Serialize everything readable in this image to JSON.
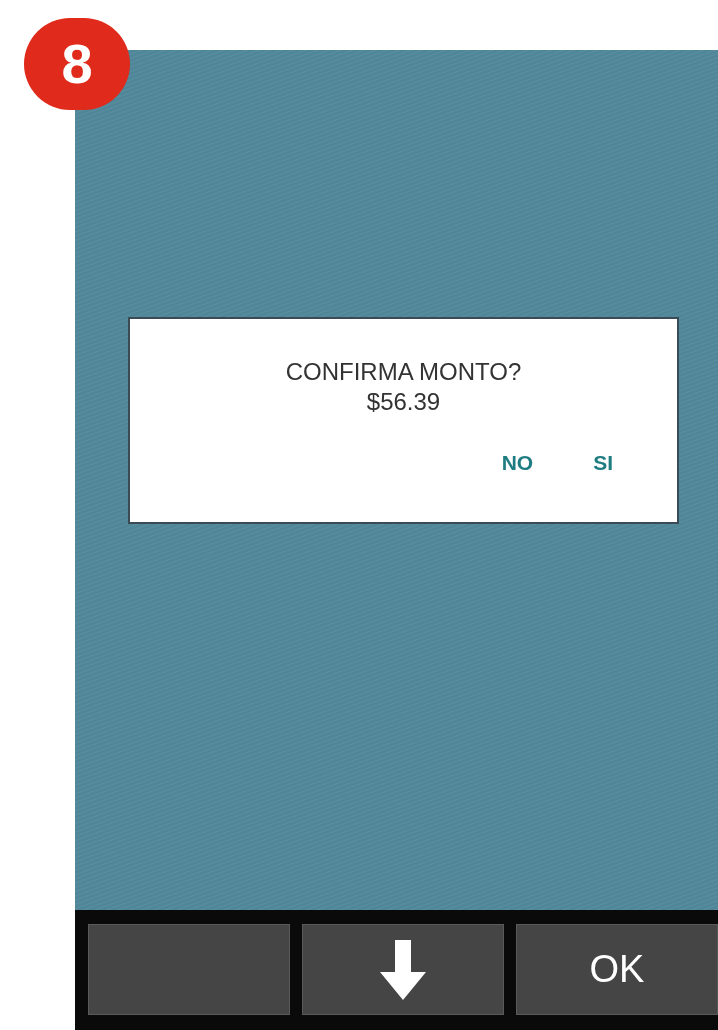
{
  "step_badge": "8",
  "dialog": {
    "title": "CONFIRMA MONTO?",
    "amount": "$56.39",
    "buttons": [
      {
        "label": "NO"
      },
      {
        "label": "SI"
      }
    ]
  },
  "softkeys": [
    {
      "kind": "blank"
    },
    {
      "kind": "down-arrow"
    },
    {
      "kind": "text",
      "label": "OK"
    }
  ]
}
